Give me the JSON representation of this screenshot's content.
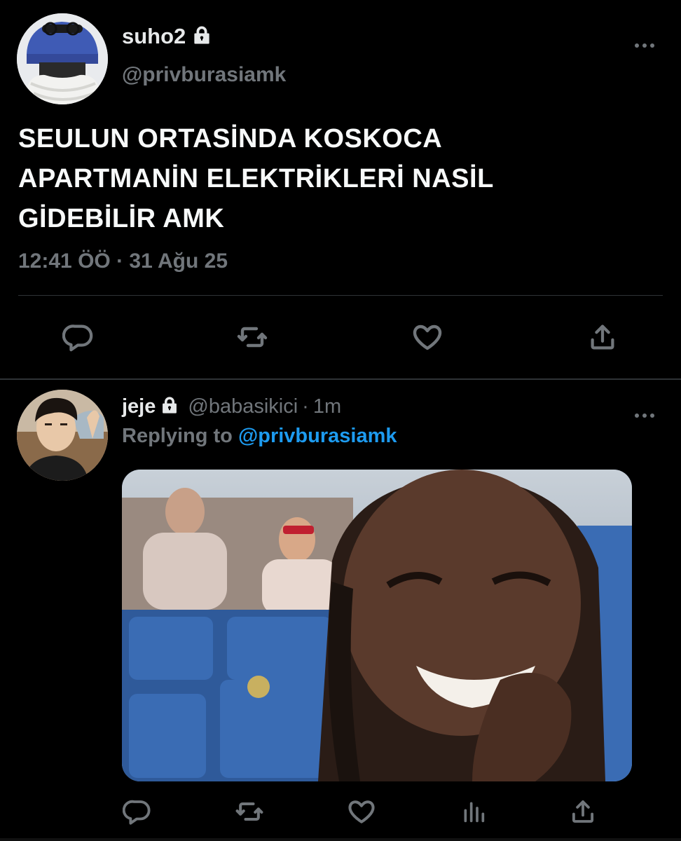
{
  "main_tweet": {
    "display_name": "suho2",
    "handle": "@privburasiamk",
    "text": "SEULUN ORTASİNDA KOSKOCA APARTMANIN ELEKTRİKLERİ NASIL GİDEBİLİR AMK",
    "text_lines": [
      "SEULUN ORTASİNDA KOSKOCA",
      "APARTMANİN ELEKTRİKLERİ NASİL",
      "GİDEBİLİR AMK"
    ],
    "time": "12:41 ÖÖ",
    "separator": "·",
    "date": "31 Ağu 25",
    "more_icon": "ellipsis-icon"
  },
  "reply_tweet": {
    "display_name": "jeje",
    "handle": "@babasikici",
    "separator": "·",
    "age": "1m",
    "replying_prefix": "Replying to",
    "replying_to": "@privburasiamk",
    "more_icon": "ellipsis-icon"
  },
  "icons": {
    "reply": "reply-icon",
    "retweet": "retweet-icon",
    "like": "heart-icon",
    "share": "share-icon",
    "analytics": "analytics-icon",
    "lock": "lock-icon"
  },
  "colors": {
    "background": "#000000",
    "text": "#e7e9ea",
    "muted": "#71767b",
    "accent": "#1d9bf0",
    "divider": "#2f3336"
  }
}
